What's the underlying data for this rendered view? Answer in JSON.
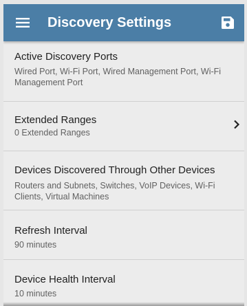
{
  "appbar": {
    "title": "Discovery Settings",
    "menu_icon": "hamburger-menu-icon",
    "save_icon": "save-icon",
    "color": "#4b7ea6"
  },
  "settings": [
    {
      "title": "Active Discovery Ports",
      "subtitle": "Wired Port, Wi-Fi Port, Wired Management Port, Wi-Fi Management Port"
    },
    {
      "title": "Extended Ranges",
      "subtitle": "0 Extended Ranges",
      "icon": "chevron-right-icon"
    },
    {
      "title": "Devices Discovered Through Other Devices",
      "subtitle": "Routers and Subnets, Switches, VoIP Devices, Wi-Fi Clients, Virtual Machines"
    },
    {
      "title": "Refresh Interval",
      "subtitle": "90 minutes"
    },
    {
      "title": "Device Health Interval",
      "subtitle": "10 minutes"
    }
  ]
}
